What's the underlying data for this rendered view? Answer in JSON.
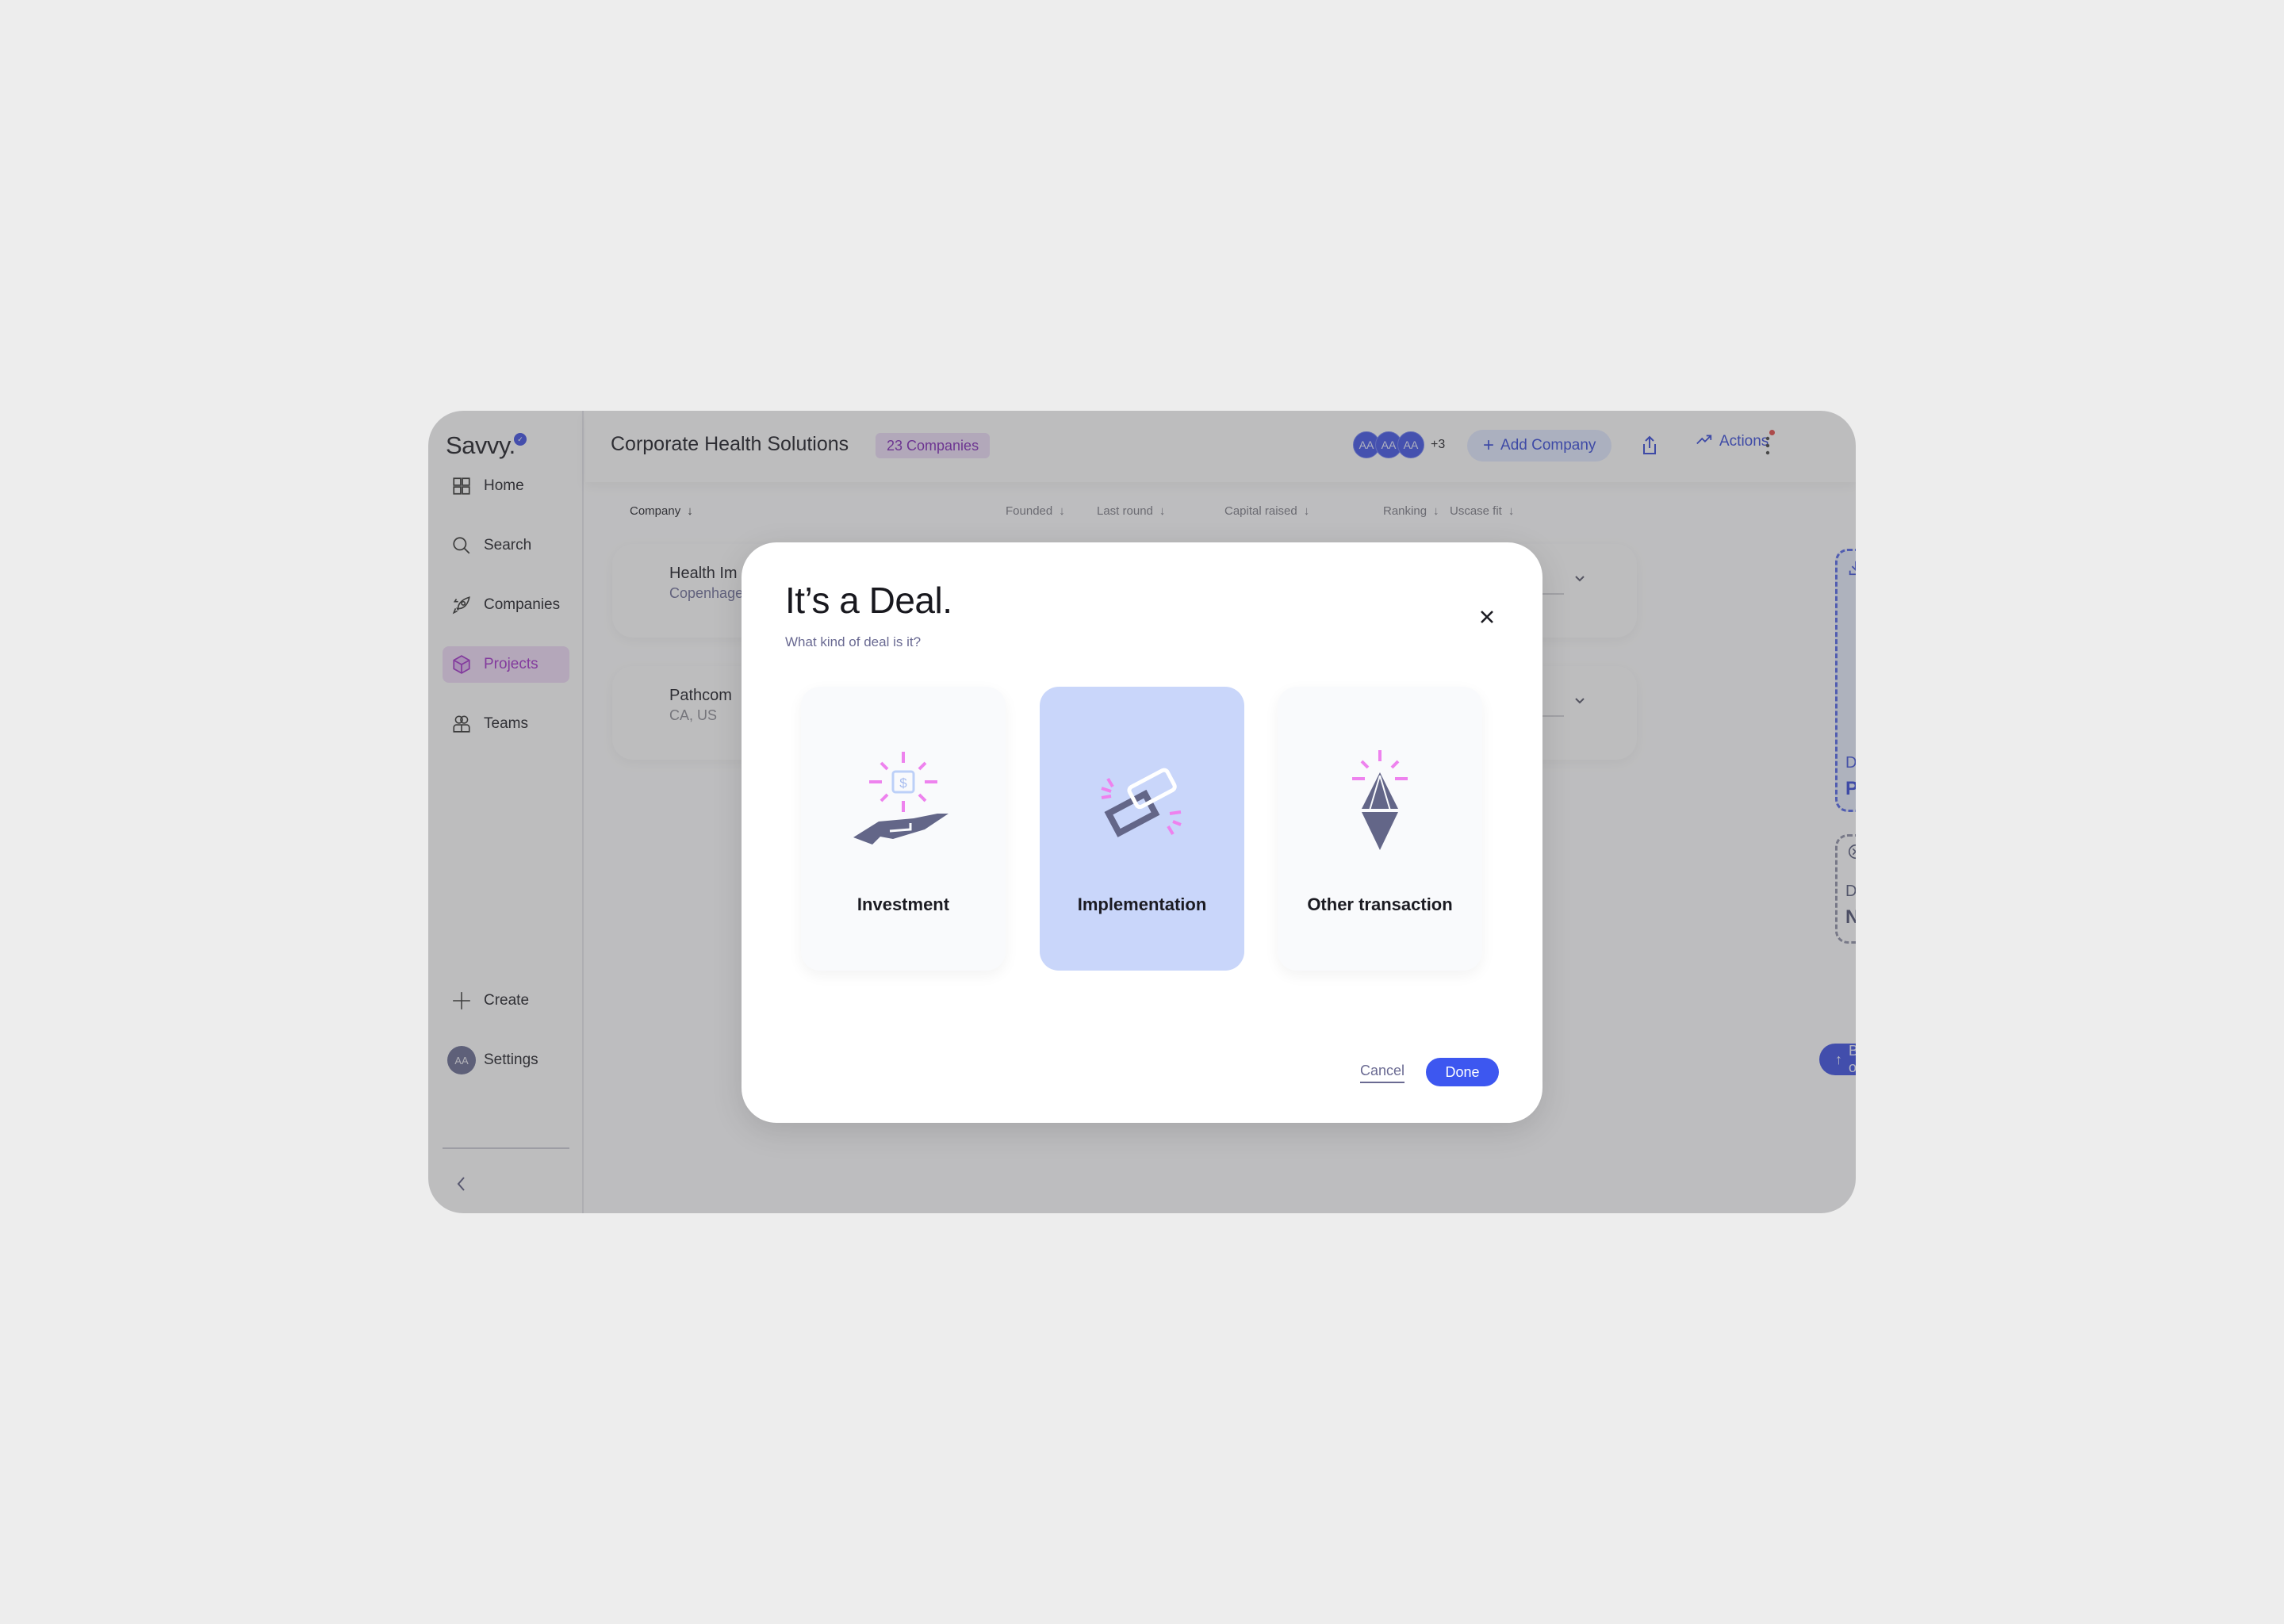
{
  "app": {
    "logo": "Savvy.",
    "logo_badge_icon": "verified-check-icon"
  },
  "sidebar": {
    "items": [
      {
        "label": "Home",
        "icon": "grid-icon",
        "active": false
      },
      {
        "label": "Search",
        "icon": "search-icon",
        "active": false
      },
      {
        "label": "Companies",
        "icon": "rocket-icon",
        "active": false
      },
      {
        "label": "Projects",
        "icon": "cube-icon",
        "active": true
      },
      {
        "label": "Teams",
        "icon": "people-icon",
        "active": false
      }
    ],
    "create_label": "Create",
    "settings_label": "Settings",
    "settings_avatar": "AA",
    "collapse_icon": "chevron-left-icon"
  },
  "header": {
    "title": "Corporate Health Solutions",
    "count_badge": "23 Companies",
    "avatars": [
      "AA",
      "AA",
      "AA"
    ],
    "more_count": "+3",
    "add_company_label": "Add Company",
    "actions_label": "Actions"
  },
  "table": {
    "columns": [
      {
        "label": "Company",
        "sort": "↓"
      },
      {
        "label": "Founded",
        "sort": "↓"
      },
      {
        "label": "Last round",
        "sort": "↓"
      },
      {
        "label": "Capital raised",
        "sort": "↓"
      },
      {
        "label": "Ranking",
        "sort": "↓"
      },
      {
        "label": "Uscase fit",
        "sort": "↓"
      }
    ],
    "rows": [
      {
        "name": "Health Im",
        "location": "Copenhage"
      },
      {
        "name": "Pathcom",
        "location": "CA, US"
      }
    ]
  },
  "dropzones": {
    "potential_fit": {
      "prefix": "Drag to",
      "label": "Potential fit"
    },
    "not_relevant": {
      "prefix": "Drop in",
      "label": "Not relevant"
    }
  },
  "back_to_overview": "Back to overview",
  "modal": {
    "title": "It’s a Deal.",
    "subtitle": "What kind of deal is it?",
    "options": [
      {
        "label": "Investment",
        "icon": "hand-money-icon",
        "selected": false
      },
      {
        "label": "Implementation",
        "icon": "chain-link-icon",
        "selected": true
      },
      {
        "label": "Other transaction",
        "icon": "diamond-icon",
        "selected": false
      }
    ],
    "cancel_label": "Cancel",
    "done_label": "Done"
  },
  "colors": {
    "accent": "#3d57f0",
    "projects_active": "#a030c8",
    "selected_card": "#c9d6fa",
    "sparkle": "#ee82ee",
    "icon_fill": "#636688"
  }
}
